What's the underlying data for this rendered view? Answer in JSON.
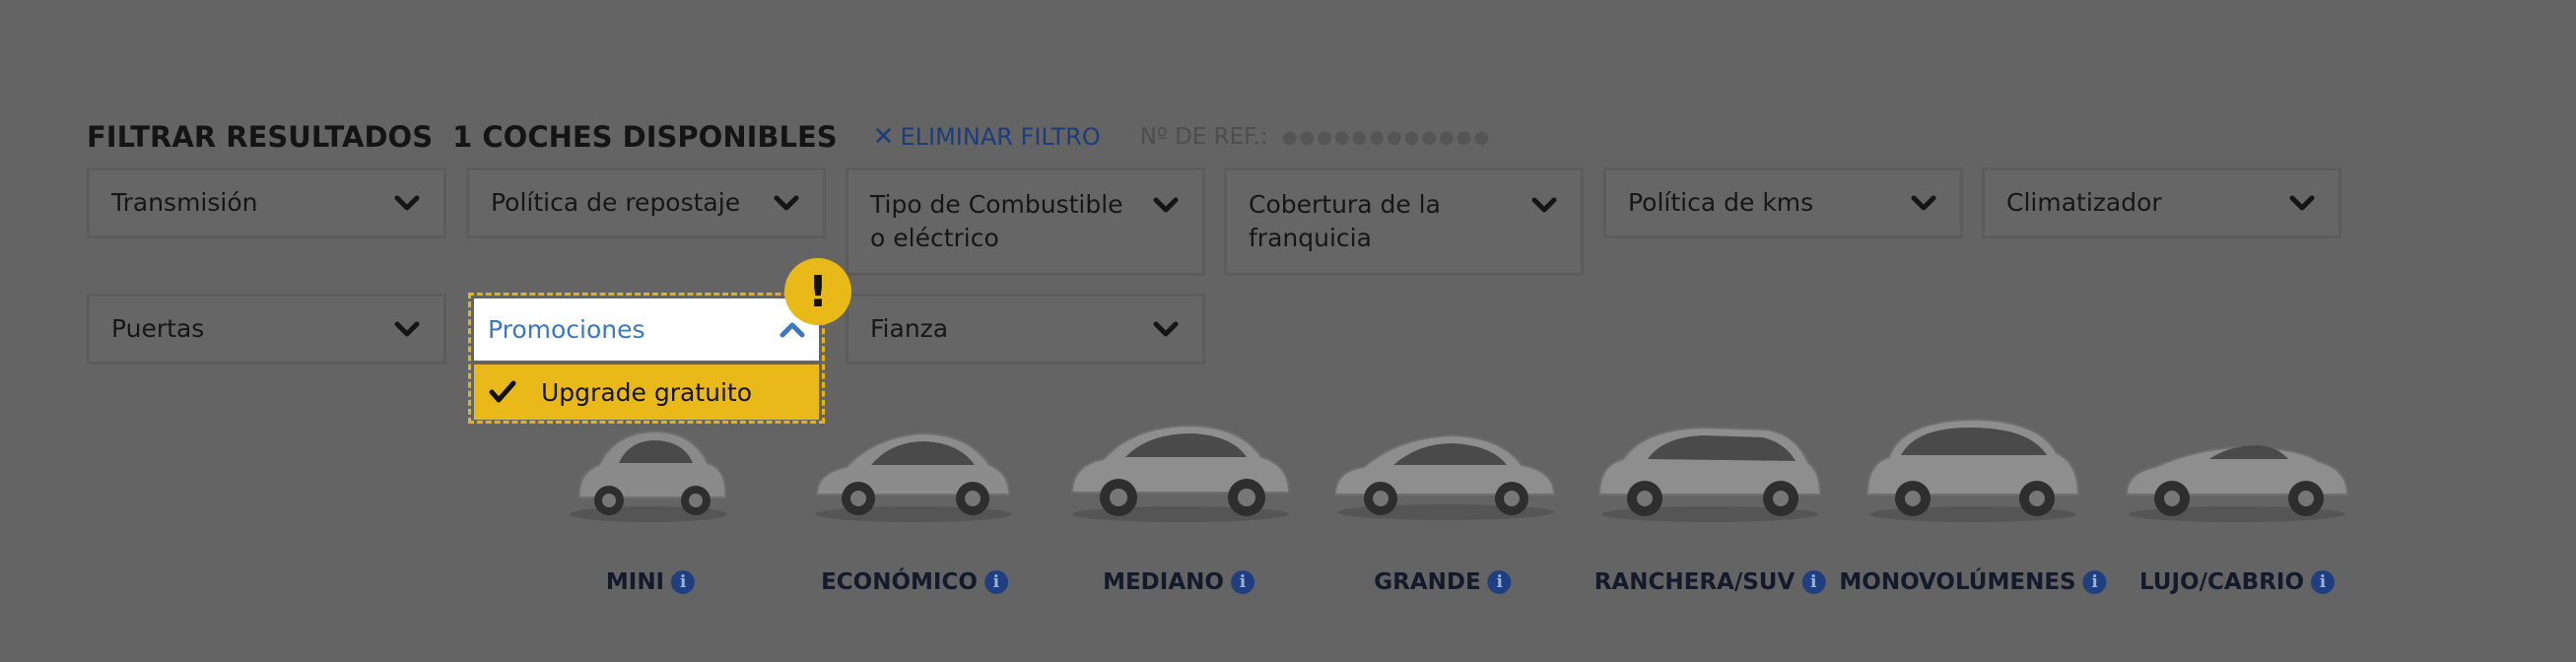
{
  "header": {
    "title": "FILTRAR RESULTADOS",
    "count": "1 COCHES DISPONIBLES",
    "clear_label": "ELIMINAR FILTRO",
    "ref_label": "Nº DE REF.:",
    "ref_value": "●●●●●●●●●●●●"
  },
  "filters": {
    "transmision": "Transmisión",
    "repostaje": "Política de repostaje",
    "combustible": "Tipo de Combustible o eléctrico",
    "franquicia": "Cobertura de la franquicia",
    "kms": "Política de kms",
    "climatizador": "Climatizador",
    "puertas": "Puertas",
    "fianza": "Fianza"
  },
  "promociones": {
    "label": "Promociones",
    "option": "Upgrade gratuito",
    "option_checked": true,
    "warning_glyph": "!"
  },
  "categories": [
    {
      "label": "MINI"
    },
    {
      "label": "ECONÓMICO"
    },
    {
      "label": "MEDIANO"
    },
    {
      "label": "GRANDE"
    },
    {
      "label": "RANCHERA/SUV"
    },
    {
      "label": "MONOVOLÚMENES"
    },
    {
      "label": "LUJO/CABRIO"
    }
  ],
  "icons": {
    "chevron": "chevron-down-icon",
    "info": "info-icon",
    "check": "check-icon",
    "close": "close-icon"
  },
  "colors": {
    "overlay_bg": "#646464",
    "accent_blue": "#3b78c4",
    "highlight_yellow": "#e8b918",
    "info_blue": "#203f80"
  }
}
